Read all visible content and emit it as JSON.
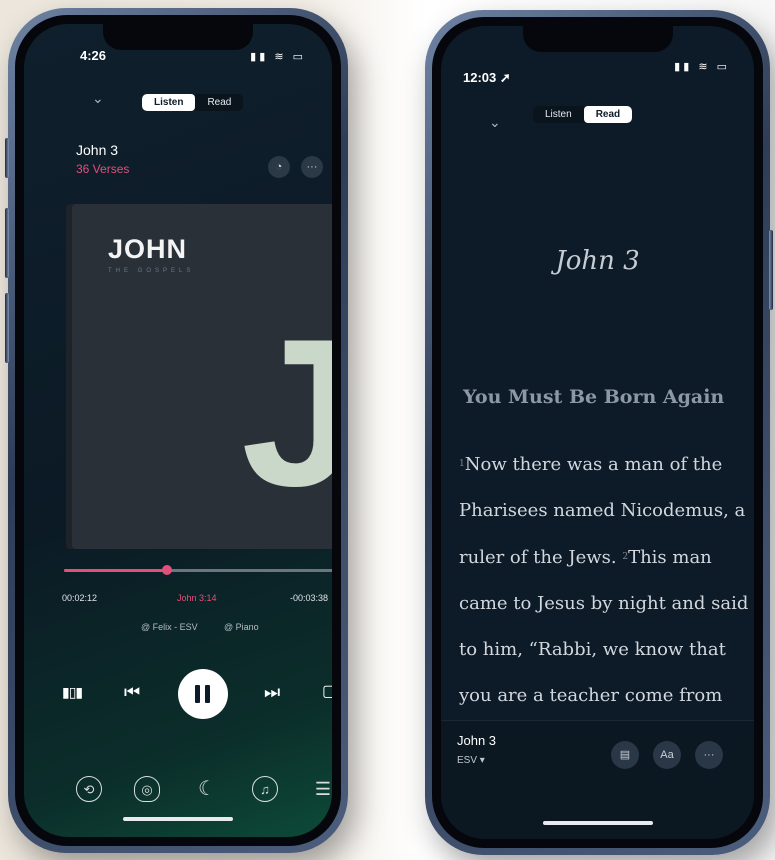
{
  "left_phone": {
    "status_time": "4:26",
    "status_icons": "▮▮ ≋ ▭",
    "collapse_icon": "chevron-down-icon",
    "tabs": [
      {
        "label": "Listen",
        "active": true
      },
      {
        "label": "Read",
        "active": false
      }
    ],
    "chapter_title": "John 3",
    "verse_count": "36 Verses",
    "cover": {
      "title": "JOHN",
      "subtitle": "THE GOSPELS",
      "letter": "J"
    },
    "progress_fraction": 0.37,
    "elapsed": "00:02:12",
    "current_verse": "John 3:14",
    "remaining": "-00:03:38",
    "narrator": "@ Felix - ESV",
    "background": "@ Piano",
    "controls": {
      "prev": "⏮",
      "next": "⏭",
      "chapters": "▮▯▮",
      "notes": "▢"
    },
    "bottom_icons": [
      "playback-speed-icon",
      "head-icon",
      "moon-icon",
      "music-note-icon",
      "sliders-icon"
    ],
    "accent_color": "#e2507a"
  },
  "right_phone": {
    "status_time": "12:03 ➚",
    "status_icons": "▮▮ ≋ ▭",
    "collapse_icon": "chevron-down-icon",
    "tabs": [
      {
        "label": "Listen",
        "active": false
      },
      {
        "label": "Read",
        "active": true
      }
    ],
    "chapter_heading": "John 3",
    "section_heading": "You Must Be Born Again",
    "verses": [
      {
        "num": "1",
        "text": "Now there was a man of the Pharisees named Nicodemus, a ruler of the Jews."
      },
      {
        "num": "2",
        "text": "This man came to Jesus by night and said to him, “Rabbi, we know that you are a teacher come from"
      }
    ],
    "bottom_title": "John 3",
    "version": "ESV ▾",
    "bottom_buttons": [
      "▤",
      "Aa",
      "···"
    ]
  }
}
